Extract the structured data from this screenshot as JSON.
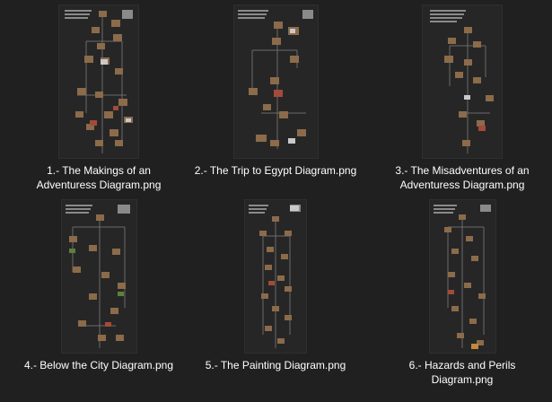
{
  "files": [
    {
      "name": "1.- The Makings of an Adventuress Diagram.png",
      "line1": "1.- The Makings of an",
      "line2": "Adventuress Diagram.png"
    },
    {
      "name": "2.- The Trip to Egypt Diagram.png",
      "line1": "2.- The Trip to Egypt Diagram.png",
      "line2": ""
    },
    {
      "name": "3.- The Misadventures of an Adventuress Diagram.png",
      "line1": "3.- The Misadventures of an",
      "line2": "Adventuress Diagram.png"
    },
    {
      "name": "4.- Below the City Diagram.png",
      "line1": "4.- Below the City Diagram.png",
      "line2": ""
    },
    {
      "name": "5.- The Painting Diagram.png",
      "line1": "5.- The Painting Diagram.png",
      "line2": ""
    },
    {
      "name": "6.- Hazards and Perils Diagram.png",
      "line1": "6.- Hazards and Perils",
      "line2": "Diagram.png"
    }
  ],
  "colors": {
    "background": "#202020",
    "thumbnail": "#262626",
    "caption": "#ffffff",
    "connector": "#6b6b6b"
  }
}
